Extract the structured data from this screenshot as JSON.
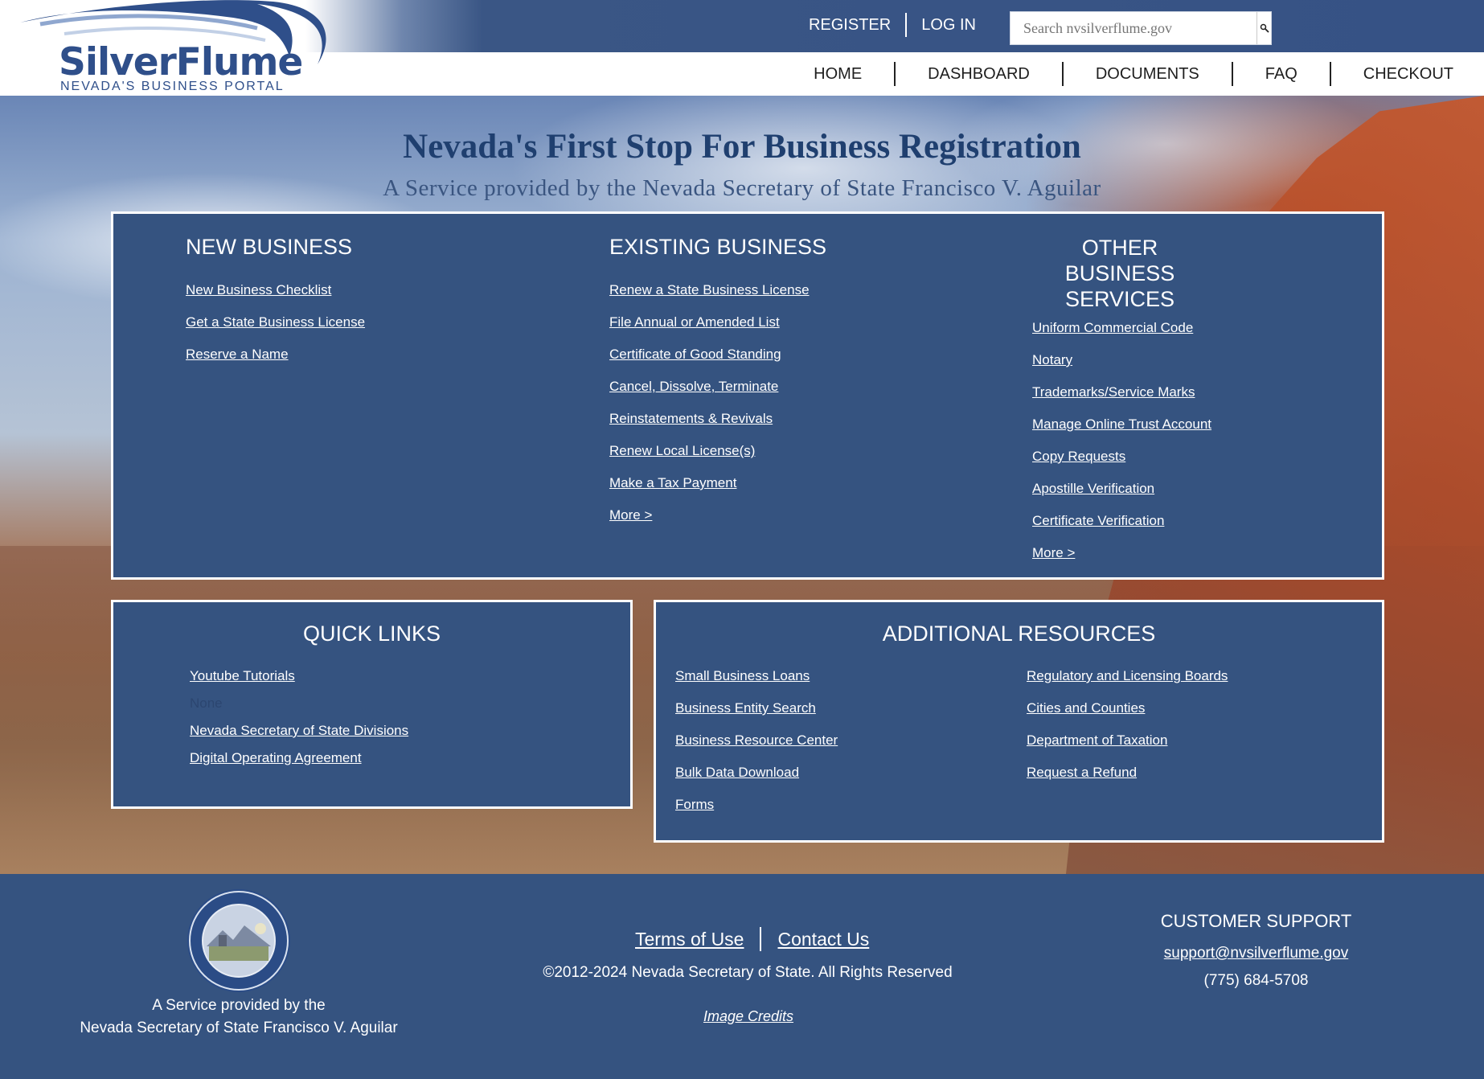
{
  "colors": {
    "primary": "#355380",
    "accent_text": "#ffffff",
    "nav_text": "#1e1e1e",
    "headline": "#1f3f6f"
  },
  "logo": {
    "title": "SilverFlume",
    "tagline": "NEVADA'S BUSINESS PORTAL"
  },
  "auth": {
    "register": "REGISTER",
    "login": "LOG IN"
  },
  "search": {
    "placeholder": "Search nvsilverflume.gov",
    "icon": "magnifier-icon"
  },
  "nav": {
    "home": "HOME",
    "dashboard": "DASHBOARD",
    "documents": "DOCUMENTS",
    "faq": "FAQ",
    "checkout": "CHECKOUT"
  },
  "hero": {
    "headline": "Nevada's First Stop For Business Registration",
    "subheadline": "A Service provided by the Nevada Secretary of State Francisco V. Aguilar"
  },
  "new_business": {
    "title": "NEW BUSINESS",
    "links": [
      "New Business Checklist",
      "Get a State Business License",
      "Reserve a Name"
    ]
  },
  "existing_business": {
    "title": "EXISTING BUSINESS",
    "links": [
      "Renew a State Business License",
      "File Annual or Amended List",
      "Certificate of Good Standing",
      "Cancel, Dissolve, Terminate",
      "Reinstatements & Revivals",
      "Renew Local License(s)",
      "Make a Tax Payment",
      "More >"
    ]
  },
  "other_services": {
    "title": "OTHER BUSINESS SERVICES",
    "links": [
      "Uniform Commercial Code",
      "Notary",
      "Trademarks/Service Marks",
      "Manage Online Trust Account",
      "Copy Requests",
      "Apostille Verification",
      "Certificate Verification",
      "More >"
    ]
  },
  "quick_links": {
    "title": "QUICK LINKS",
    "links": [
      "Youtube Tutorials",
      "Nevada Secretary of State Divisions",
      "Digital Operating Agreement"
    ],
    "none_text": "None"
  },
  "additional_resources": {
    "title": "ADDITIONAL RESOURCES",
    "left": [
      "Small Business Loans",
      "Business Entity Search",
      "Business Resource Center",
      "Bulk Data Download",
      "Forms"
    ],
    "right": [
      "Regulatory and Licensing Boards",
      "Cities and Counties",
      "Department of Taxation",
      "Request a Refund"
    ]
  },
  "footer": {
    "seal_line1": "A Service provided by the",
    "seal_line2": "Nevada Secretary of State Francisco V. Aguilar",
    "terms": "Terms of Use",
    "contact": "Contact Us",
    "copyright": "©2012-2024 Nevada Secretary of State. All Rights Reserved",
    "credits": "Image Credits",
    "support_title": "CUSTOMER SUPPORT",
    "support_email": "support@nvsilverflume.gov",
    "support_phone": "(775) 684-5708"
  }
}
